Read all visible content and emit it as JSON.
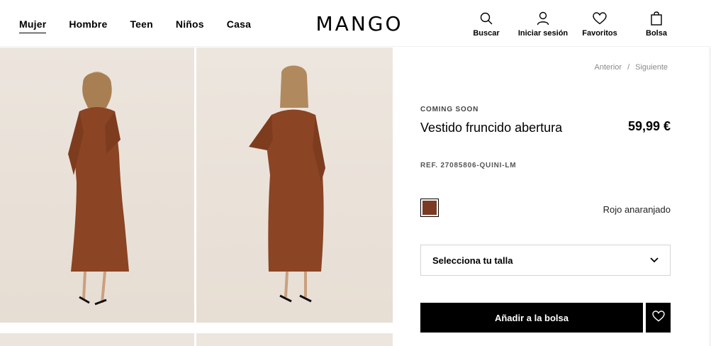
{
  "header": {
    "nav": [
      "Mujer",
      "Hombre",
      "Teen",
      "Niños",
      "Casa"
    ],
    "logo": "MANGO",
    "actions": [
      {
        "label": "Buscar",
        "icon": "search-icon"
      },
      {
        "label": "Iniciar sesión",
        "icon": "user-icon"
      },
      {
        "label": "Favoritos",
        "icon": "heart-icon"
      },
      {
        "label": "Bolsa",
        "icon": "bag-icon"
      }
    ]
  },
  "pager": {
    "prev": "Anterior",
    "sep": "/",
    "next": "Siguiente"
  },
  "product": {
    "status": "COMING SOON",
    "title": "Vestido fruncido abertura",
    "price": "59,99 €",
    "ref": "REF. 27085806-QUINI-LM",
    "color": {
      "name": "Rojo anaranjado",
      "hex": "#7a3a24"
    },
    "size_placeholder": "Selecciona tu talla",
    "add_to_bag": "Añadir a la bolsa"
  }
}
